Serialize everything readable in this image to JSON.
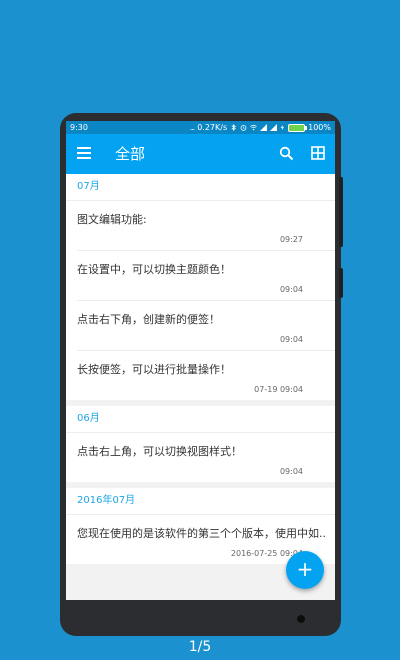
{
  "status_bar": {
    "time": "9:30",
    "dots": "...",
    "speed": "0.27K/s",
    "battery": "100%"
  },
  "app_bar": {
    "title": "全部",
    "menu_icon": "menu-icon",
    "search_icon": "search-icon",
    "view_icon": "grid-view-icon"
  },
  "sections": [
    {
      "header": "07月",
      "notes": [
        {
          "text": "图文编辑功能:",
          "time": "09:27"
        },
        {
          "text": "在设置中，可以切换主题颜色！",
          "time": "09:04"
        },
        {
          "text": "点击右下角，创建新的便签！",
          "time": "09:04"
        },
        {
          "text": "长按便签，可以进行批量操作！",
          "time": "07-19 09:04"
        }
      ]
    },
    {
      "header": "06月",
      "notes": [
        {
          "text": "点击右上角，可以切换视图样式！",
          "time": "09:04"
        }
      ]
    },
    {
      "header": "2016年07月",
      "notes": [
        {
          "text": "您现在使用的是该软件的第三个个版本，使用中如...",
          "time": "2016-07-25 09:04"
        }
      ]
    }
  ],
  "fab": {
    "label": "+"
  },
  "pager": {
    "text": "1/5"
  },
  "colors": {
    "background": "#1b91cf",
    "app_bar": "#04a3f1",
    "status_bar": "#0a86c5",
    "section_header": "#1ea5e7"
  }
}
